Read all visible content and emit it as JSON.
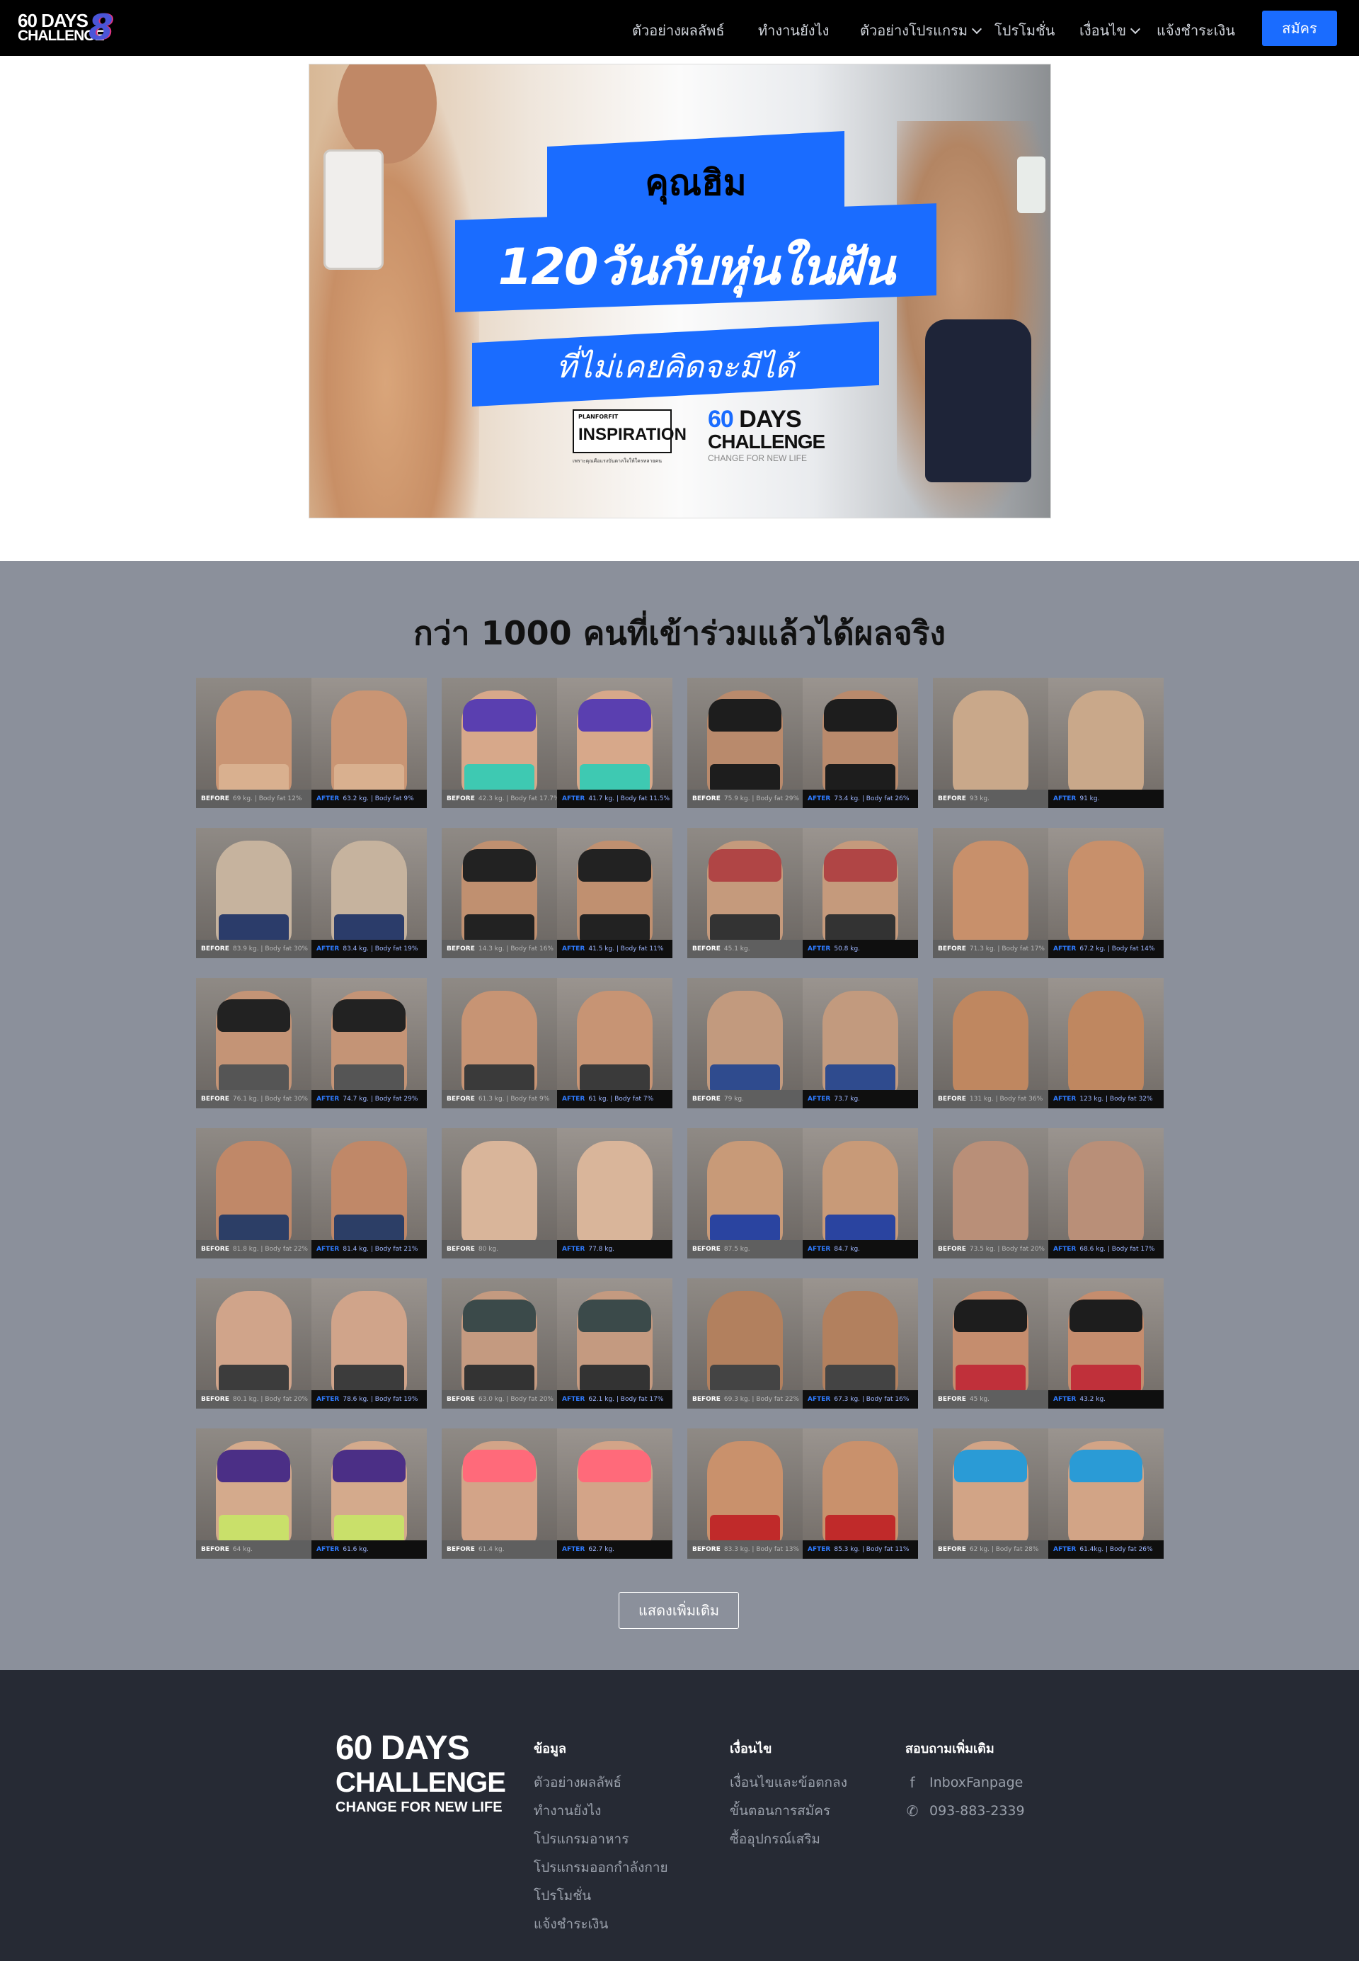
{
  "nav": {
    "logo": {
      "line1": "60 DAYS",
      "line2": "CHALLENGE",
      "badge": "8"
    },
    "items": [
      {
        "label": "ตัวอย่างผลลัพธ์",
        "dropdown": false
      },
      {
        "label": "ทำงานยังไง",
        "dropdown": false
      },
      {
        "label": "ตัวอย่างโปรแกรม",
        "dropdown": true
      },
      {
        "label": "โปรโมชั่น",
        "dropdown": false
      },
      {
        "label": "เงื่อนไข",
        "dropdown": true
      },
      {
        "label": "แจ้งชำระเงิน",
        "dropdown": false
      }
    ],
    "signup_label": "สมัคร",
    "colors": {
      "bg": "#000000",
      "accent": "#1a6cff"
    }
  },
  "hero": {
    "title_name": "คุณฮิม",
    "title_main": "120วันกับหุ่นในฝัน",
    "title_sub": "ที่ไม่เคยคิดจะมีได้",
    "inspiration_small": "PLANFORFIT",
    "inspiration_big": "INSPIRATION",
    "inspiration_tag": "เพราะคุณคือแรงบันดาลใจให้ใครหลายคน",
    "logo_line1_num": "60",
    "logo_line1_rest": " DAYS",
    "logo_line2": "CHALLENGE",
    "logo_line3": "CHANGE FOR NEW LIFE"
  },
  "results": {
    "title": "กว่า 1000 คนที่เข้าร่วมแล้วได้ผลจริง",
    "before_label": "BEFORE",
    "after_label": "AFTER",
    "cards": [
      {
        "before": "69 kg. | Body fat 12%",
        "after": "63.2 kg. | Body fat 9%",
        "skin": "#c99574",
        "female": false,
        "bottom": "#d9b08f"
      },
      {
        "before": "42.3 kg. | Body fat 17.7%",
        "after": "41.7 kg. | Body fat 11.5%",
        "skin": "#d7a88a",
        "female": true,
        "bra": "#5a3fb0",
        "bottom": "#3ec9b2"
      },
      {
        "before": "75.9 kg. | Body fat 29%",
        "after": "73.4 kg. | Body fat 26%",
        "skin": "#b98a6c",
        "female": true,
        "bra": "#1d1d1d",
        "bottom": "#1d1d1d"
      },
      {
        "before": "93 kg.",
        "after": "91 kg.",
        "skin": "#c9a88a",
        "female": false,
        "bottom": "#c9a88a"
      },
      {
        "before": "83.9 kg. | Body fat 30%",
        "after": "83.4 kg. | Body fat 19%",
        "skin": "#c6b39e",
        "female": false,
        "bottom": "#2b3c6a"
      },
      {
        "before": "14.3 kg. | Body fat 16%",
        "after": "41.5 kg. | Body fat 11%",
        "skin": "#c09070",
        "female": true,
        "bra": "#222",
        "bottom": "#222"
      },
      {
        "before": "45.1 kg.",
        "after": "50.8 kg.",
        "skin": "#c59a7c",
        "female": true,
        "bra": "#b04545",
        "bottom": "#333"
      },
      {
        "before": "71.3 kg. | Body fat 17%",
        "after": "67.2 kg. | Body fat 14%",
        "skin": "#c8906b",
        "female": false,
        "bottom": "#c8906b"
      },
      {
        "before": "76.1 kg. | Body fat 30%",
        "after": "74.7 kg. | Body fat 29%",
        "skin": "#c49476",
        "female": true,
        "bra": "#222",
        "bottom": "#555"
      },
      {
        "before": "61.3 kg. | Body fat 9%",
        "after": "61 kg. | Body fat 7%",
        "skin": "#c79474",
        "female": false,
        "bottom": "#3a3a3a"
      },
      {
        "before": "79 kg.",
        "after": "73.7 kg.",
        "skin": "#c29a7e",
        "female": false,
        "bottom": "#2f4b8e"
      },
      {
        "before": "131 kg. | Body fat 36%",
        "after": "123 kg. | Body fat 32%",
        "skin": "#bf8760",
        "female": false,
        "bottom": "#bf8760"
      },
      {
        "before": "81.8 kg. | Body fat 22%",
        "after": "81.4 kg. | Body fat 21%",
        "skin": "#c08868",
        "female": false,
        "bottom": "#2c3e66"
      },
      {
        "before": "80 kg.",
        "after": "77.8 kg.",
        "skin": "#d9b59a",
        "female": false,
        "bottom": "#d9b59a"
      },
      {
        "before": "87.5 kg.",
        "after": "84.7 kg.",
        "skin": "#c89a78",
        "female": false,
        "bottom": "#2a44a0"
      },
      {
        "before": "73.5 kg. | Body fat 20%",
        "after": "68.6 kg. | Body fat 17%",
        "skin": "#b98f78",
        "female": false,
        "bottom": "#b98f78"
      },
      {
        "before": "80.1 kg. | Body fat 20%",
        "after": "78.6 kg. | Body fat 19%",
        "skin": "#d0a48a",
        "female": false,
        "bottom": "#3c3c3c"
      },
      {
        "before": "63.0 kg. | Body fat 20%",
        "after": "62.1 kg. | Body fat 17%",
        "skin": "#c49a80",
        "female": true,
        "bra": "#3b4a4a",
        "bottom": "#333"
      },
      {
        "before": "69.3 kg. | Body fat 22%",
        "after": "67.3 kg. | Body fat 16%",
        "skin": "#b2805e",
        "female": false,
        "bottom": "#444"
      },
      {
        "before": "45 kg.",
        "after": "43.2 kg.",
        "skin": "#c58d6e",
        "female": true,
        "bra": "#1d1d1d",
        "bottom": "#c0303a"
      },
      {
        "before": "64 kg.",
        "after": "61.6 kg.",
        "skin": "#d4aa8c",
        "female": true,
        "bra": "#4b2f86",
        "bottom": "#c9e06a"
      },
      {
        "before": "61.4 kg.",
        "after": "62.7 kg.",
        "skin": "#d3a488",
        "female": true,
        "bra": "#ff6a7a",
        "bottom": "#d3a488"
      },
      {
        "before": "83.3 kg. | Body fat 13%",
        "after": "85.3 kg. | Body fat 11%",
        "skin": "#c9916c",
        "female": false,
        "bottom": "#c02a2a"
      },
      {
        "before": "62 kg. | Body fat 28%",
        "after": "61.4kg. | Body fat 26%",
        "skin": "#d2a486",
        "female": true,
        "bra": "#2a9bd6",
        "bottom": "#d2a486"
      }
    ],
    "more_label": "แสดงเพิ่มเติม"
  },
  "footer": {
    "logo": {
      "line1": "60 DAYS",
      "line2": "CHALLENGE",
      "line3": "CHANGE FOR NEW LIFE"
    },
    "col_info": {
      "title": "ข้อมูล",
      "links": [
        "ตัวอย่างผลลัพธ์",
        "ทำงานยังไง",
        "โปรแกรมอาหาร",
        "โปรแกรมออกกำลังกาย",
        "โปรโมชั่น",
        "แจ้งชำระเงิน"
      ]
    },
    "col_terms": {
      "title": "เงื่อนไข",
      "links": [
        "เงื่อนไขและข้อตกลง",
        "ขั้นตอนการสมัคร",
        "ซื้ออุปกรณ์เสริม"
      ]
    },
    "col_contact": {
      "title": "สอบถามเพิ่มเติม",
      "facebook": "InboxFanpage",
      "phone": "093-883-2339",
      "facebook_icon": "facebook-icon",
      "phone_icon": "phone-icon"
    }
  }
}
